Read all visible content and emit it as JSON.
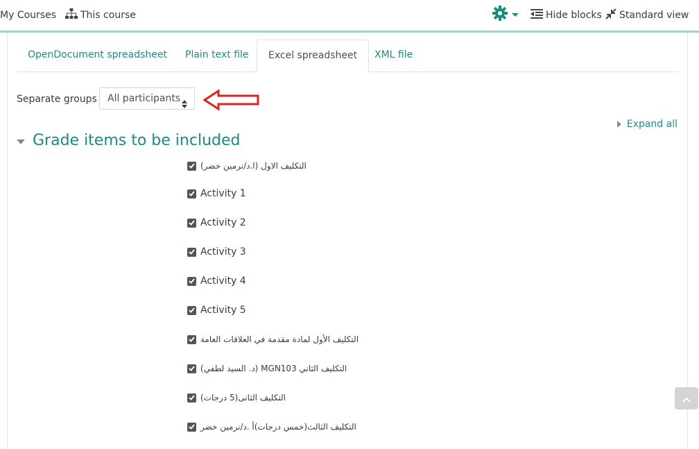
{
  "topbar": {
    "my_courses": "My Courses",
    "this_course": "This course",
    "hide_blocks": "Hide blocks",
    "standard_view": "Standard view",
    "accent_color": "#1b8d7e"
  },
  "tabs": [
    {
      "label": "OpenDocument spreadsheet",
      "active": false
    },
    {
      "label": "Plain text file",
      "active": false
    },
    {
      "label": "Excel spreadsheet",
      "active": true
    },
    {
      "label": "XML file",
      "active": false
    }
  ],
  "groups": {
    "label": "Separate groups",
    "selected": "All participants"
  },
  "expand_all": "Expand all",
  "section": {
    "title": "Grade items to be included",
    "items": [
      {
        "label": "التكليف الاول (ا.د/نرمين خضر)",
        "checked": true
      },
      {
        "label": "Activity 1",
        "checked": true
      },
      {
        "label": "Activity 2",
        "checked": true
      },
      {
        "label": "Activity 3",
        "checked": true
      },
      {
        "label": "Activity 4",
        "checked": true
      },
      {
        "label": "Activity 5",
        "checked": true
      },
      {
        "label": "التكليف الأول لمادة مقدمة في العلاقات العامة",
        "checked": true
      },
      {
        "label": "(د. السيد لطفي) MGN103 التكليف الثاني",
        "checked": true
      },
      {
        "label": "التكليف الثانى(5 درجات)",
        "checked": true
      },
      {
        "label": "التكليف الثالث(خمس درجات)أ .د/نرمين خضر",
        "checked": true
      }
    ]
  }
}
